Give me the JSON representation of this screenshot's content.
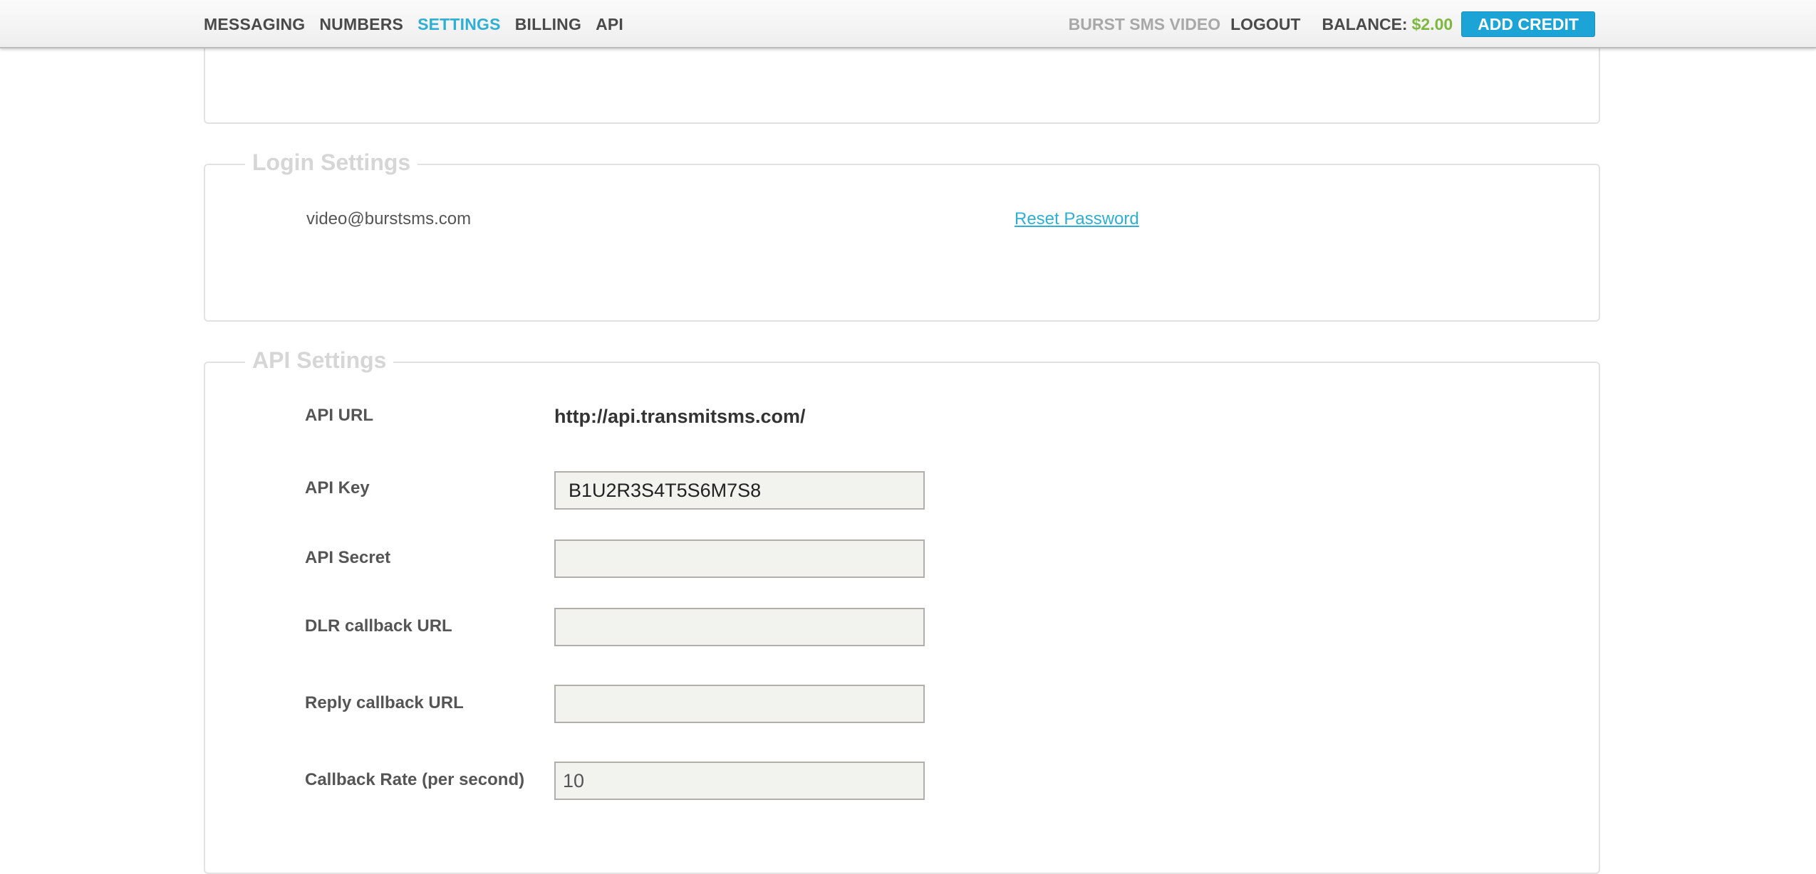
{
  "nav": {
    "items": [
      {
        "label": "MESSAGING",
        "active": false
      },
      {
        "label": "NUMBERS",
        "active": false
      },
      {
        "label": "SETTINGS",
        "active": true
      },
      {
        "label": "BILLING",
        "active": false
      },
      {
        "label": "API",
        "active": false
      }
    ],
    "account_name": "BURST SMS VIDEO",
    "logout_label": "LOGOUT",
    "balance_label": "BALANCE:",
    "balance_value": "$2.00",
    "add_credit_label": "ADD CREDIT"
  },
  "login_settings": {
    "title": "Login Settings",
    "email": "video@burstsms.com",
    "reset_password_label": "Reset Password"
  },
  "api_settings": {
    "title": "API Settings",
    "api_url_label": "API URL",
    "api_url_value": "http://api.transmitsms.com/",
    "api_key_label": "API Key",
    "api_key_value": "B1U2R3S4T5S6M7S8",
    "api_secret_label": "API Secret",
    "api_secret_value": "",
    "dlr_callback_label": "DLR callback URL",
    "dlr_callback_value": "",
    "reply_callback_label": "Reply callback URL",
    "reply_callback_value": "",
    "callback_rate_label": "Callback Rate (per second)",
    "callback_rate_value": "10"
  },
  "colors": {
    "accent": "#2eafd3",
    "button": "#1da4d6",
    "balance": "#7cb83d",
    "legend": "#d6d6d6"
  }
}
